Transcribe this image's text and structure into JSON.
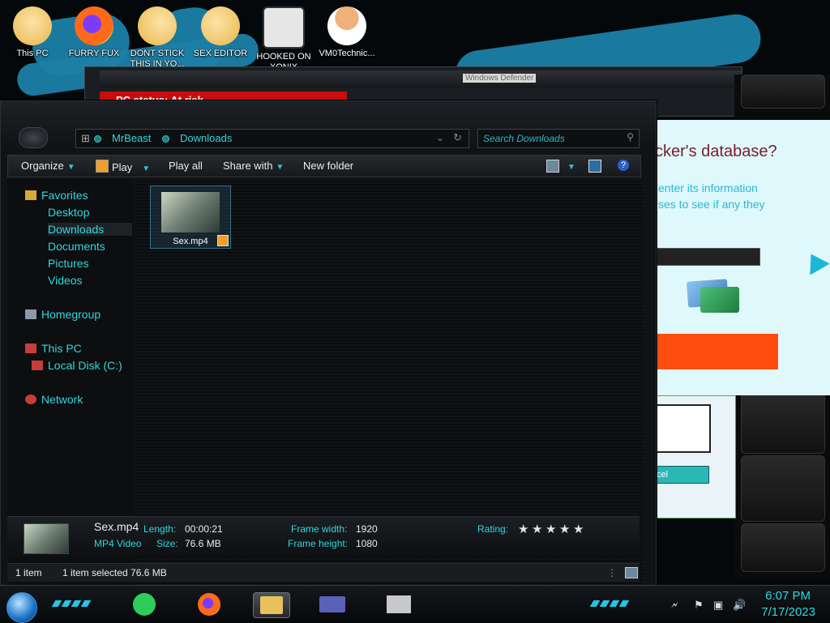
{
  "desktop": {
    "icons": [
      {
        "label": "This PC",
        "icon": "this-pc-icon",
        "color": "#f5d78a"
      },
      {
        "label": "FURRY FUX",
        "icon": "firefox-icon",
        "color": "#ff6a1a"
      },
      {
        "label": "DONT STICK THIS IN YO...",
        "icon": "video-file-icon",
        "color": "#f5d78a"
      },
      {
        "label": "SEX EDITOR",
        "icon": "video-file-icon",
        "color": "#f5d78a"
      },
      {
        "label": "HOOKED ON XONIX",
        "icon": "game-icon",
        "color": "#d8d8d8"
      },
      {
        "label": "VM0Technic...",
        "icon": "doctor-icon",
        "color": "#f2b07a"
      }
    ]
  },
  "background_windows": {
    "defender_title": "Windows Defender",
    "defender_status": "PC status: At risk",
    "phish_title": "cker's database?",
    "phish_desc_line1": "enter its information",
    "phish_desc_line2": "ses to see if any they",
    "cancel_label": "cel"
  },
  "explorer": {
    "breadcrumb": [
      "MrBeast",
      "Downloads"
    ],
    "search_placeholder": "Search Downloads",
    "toolbar": {
      "organize": "Organize",
      "play": "Play",
      "play_all": "Play all",
      "share_with": "Share with",
      "new_folder": "New folder"
    },
    "nav": {
      "favorites": "Favorites",
      "desktop": "Desktop",
      "downloads": "Downloads",
      "documents": "Documents",
      "pictures": "Pictures",
      "videos": "Videos",
      "homegroup": "Homegroup",
      "this_pc": "This PC",
      "local_disk": "Local Disk (C:)",
      "network": "Network"
    },
    "files": [
      {
        "name": "Sex.mp4"
      }
    ],
    "details": {
      "name": "Sex.mp4",
      "type": "MP4 Video",
      "length_label": "Length:",
      "length": "00:00:21",
      "size_label": "Size:",
      "size": "76.6 MB",
      "frame_width_label": "Frame width:",
      "frame_width": "1920",
      "frame_height_label": "Frame height:",
      "frame_height": "1080",
      "rating_label": "Rating:",
      "rating_stars": 0
    },
    "status": {
      "count": "1 item",
      "selected": "1 item selected  76.6 MB"
    }
  },
  "taskbar": {
    "time": "6:07 PM",
    "date": "7/17/2023",
    "accent": "#2fd7de"
  }
}
